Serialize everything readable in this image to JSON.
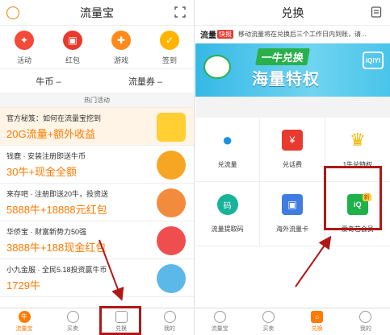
{
  "left": {
    "title": "流量宝",
    "features": [
      {
        "label": "活动",
        "icon": "gift-icon",
        "color": "#f44a3a"
      },
      {
        "label": "红包",
        "icon": "red-packet-icon",
        "color": "#e83a2e"
      },
      {
        "label": "游戏",
        "icon": "gamepad-icon",
        "color": "#ff8a1a"
      },
      {
        "label": "签到",
        "icon": "calendar-icon",
        "color": "#ffb400"
      }
    ],
    "coins": {
      "niu": "牛币  –",
      "coupon": "流量券  –"
    },
    "hot_title": "热门活动",
    "activities": [
      {
        "desc": "官方秘笈：如何在流量宝挖到",
        "bonus": "20G流量+额外收益"
      },
      {
        "desc": "钱鹿 · 安装注册即送牛币",
        "bonus": "30牛+现金全额"
      },
      {
        "desc": "来存吧 · 注册即送20牛，投资送",
        "bonus": "5888牛+18888元红包"
      },
      {
        "desc": "华侨宝 · 财富新势力50强",
        "bonus": "3888牛+188现金红包"
      },
      {
        "desc": "小九金服 · 全民5.18投资赢牛币",
        "bonus": "1729牛"
      }
    ],
    "tabs": [
      {
        "label": "流量宝",
        "glyph": "牛"
      },
      {
        "label": "买卖",
        "glyph": ""
      },
      {
        "label": "兑换",
        "glyph": ""
      },
      {
        "label": "我的",
        "glyph": ""
      }
    ]
  },
  "right": {
    "title": "兑换",
    "ticker_tag": "流量",
    "ticker_badge": "快报",
    "ticker_text": "移动流量将在兑换后三个工作日内到账，请...",
    "banner_line1": "一牛兑换",
    "banner_line2": "海量特权",
    "banner_brand": "iQIYI",
    "items": [
      {
        "label": "兑流量",
        "icon": "water-drop-icon",
        "color": "#1e90e0",
        "glyph": "💧"
      },
      {
        "label": "兑话费",
        "icon": "phone-bill-icon",
        "color": "#e83a2e",
        "glyph": "¥"
      },
      {
        "label": "1牛兑特权",
        "icon": "crown-icon",
        "color": "#f6b400",
        "glyph": "♛"
      },
      {
        "label": "流量提取码",
        "icon": "code-icon",
        "color": "#19b39a",
        "glyph": "码"
      },
      {
        "label": "海外流量卡",
        "icon": "sim-card-icon",
        "color": "#3f7de0",
        "glyph": "▣"
      },
      {
        "label": "爱奇艺会员",
        "icon": "iqiyi-icon",
        "color": "#1fb24a",
        "glyph": "iQ",
        "badge": "新"
      }
    ],
    "tabs": [
      {
        "label": "流量宝",
        "glyph": ""
      },
      {
        "label": "买卖",
        "glyph": ""
      },
      {
        "label": "兑换",
        "glyph": "⌂"
      },
      {
        "label": "我的",
        "glyph": ""
      }
    ]
  }
}
